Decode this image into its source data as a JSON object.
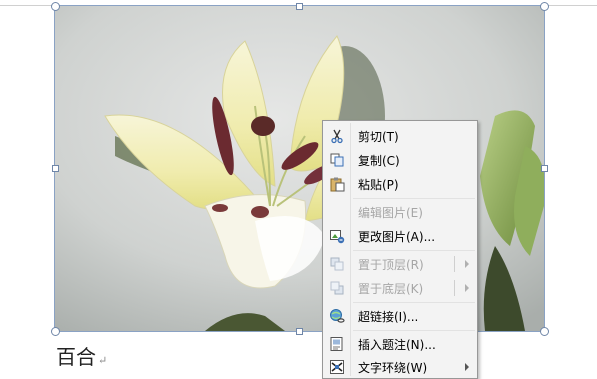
{
  "document": {
    "caption": "百合",
    "paragraph_mark": "↵"
  },
  "context_menu": {
    "items": [
      {
        "label": "剪切(T)",
        "icon": "scissors-icon",
        "enabled": true
      },
      {
        "label": "复制(C)",
        "icon": "copy-icon",
        "enabled": true
      },
      {
        "label": "粘贴(P)",
        "icon": "paste-icon",
        "enabled": true
      },
      {
        "label": "编辑图片(E)",
        "icon": "",
        "enabled": false
      },
      {
        "label": "更改图片(A)...",
        "icon": "change-picture-icon",
        "enabled": true
      },
      {
        "label": "置于顶层(R)",
        "icon": "bring-to-front-icon",
        "enabled": false,
        "submenu": true
      },
      {
        "label": "置于底层(K)",
        "icon": "send-to-back-icon",
        "enabled": false,
        "submenu": true
      },
      {
        "label": "超链接(I)...",
        "icon": "hyperlink-icon",
        "enabled": true
      },
      {
        "label": "插入题注(N)...",
        "icon": "insert-caption-icon",
        "enabled": true
      },
      {
        "label": "文字环绕(W)",
        "icon": "text-wrap-icon",
        "enabled": true,
        "submenu": true
      }
    ]
  },
  "colors": {
    "selection_border": "#8aa2c4",
    "menu_background": "#f3f3f3",
    "disabled_text": "#a6a6a6"
  }
}
